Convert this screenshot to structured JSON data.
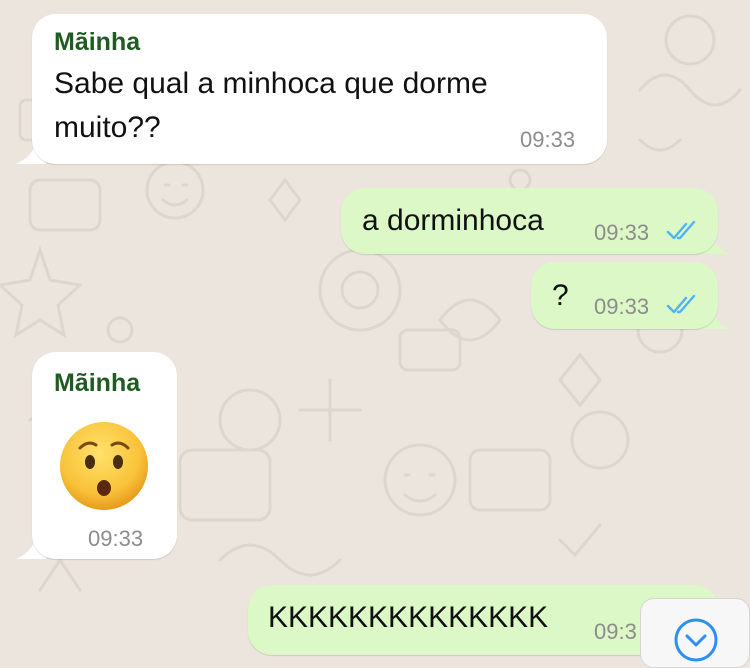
{
  "chat": {
    "messages": [
      {
        "direction": "incoming",
        "sender": "Mãinha",
        "text": "Sabe qual a minhoca que dorme muito??",
        "text_line1": "Sabe qual a minhoca que dorme",
        "text_line2": "muito??",
        "time": "09:33"
      },
      {
        "direction": "outgoing",
        "text": "a dorminhoca",
        "time": "09:33",
        "status": "read"
      },
      {
        "direction": "outgoing",
        "text": "?",
        "time": "09:33",
        "status": "read"
      },
      {
        "direction": "incoming",
        "sender": "Mãinha",
        "emoji": "hushed-face",
        "time": "09:33"
      },
      {
        "direction": "outgoing",
        "text": "KKKKKKKKKKKKKK",
        "time": "09:3"
      }
    ]
  },
  "colors": {
    "background": "#ece5dd",
    "incoming_bubble": "#ffffff",
    "outgoing_bubble": "#dcf8c6",
    "sender_name": "#1f5c22",
    "read_ticks": "#4fb3f6",
    "timestamp": "#8c8c8c"
  },
  "scroll_down_button": {
    "icon": "chevron-down-icon",
    "color": "#2f8ff1"
  }
}
